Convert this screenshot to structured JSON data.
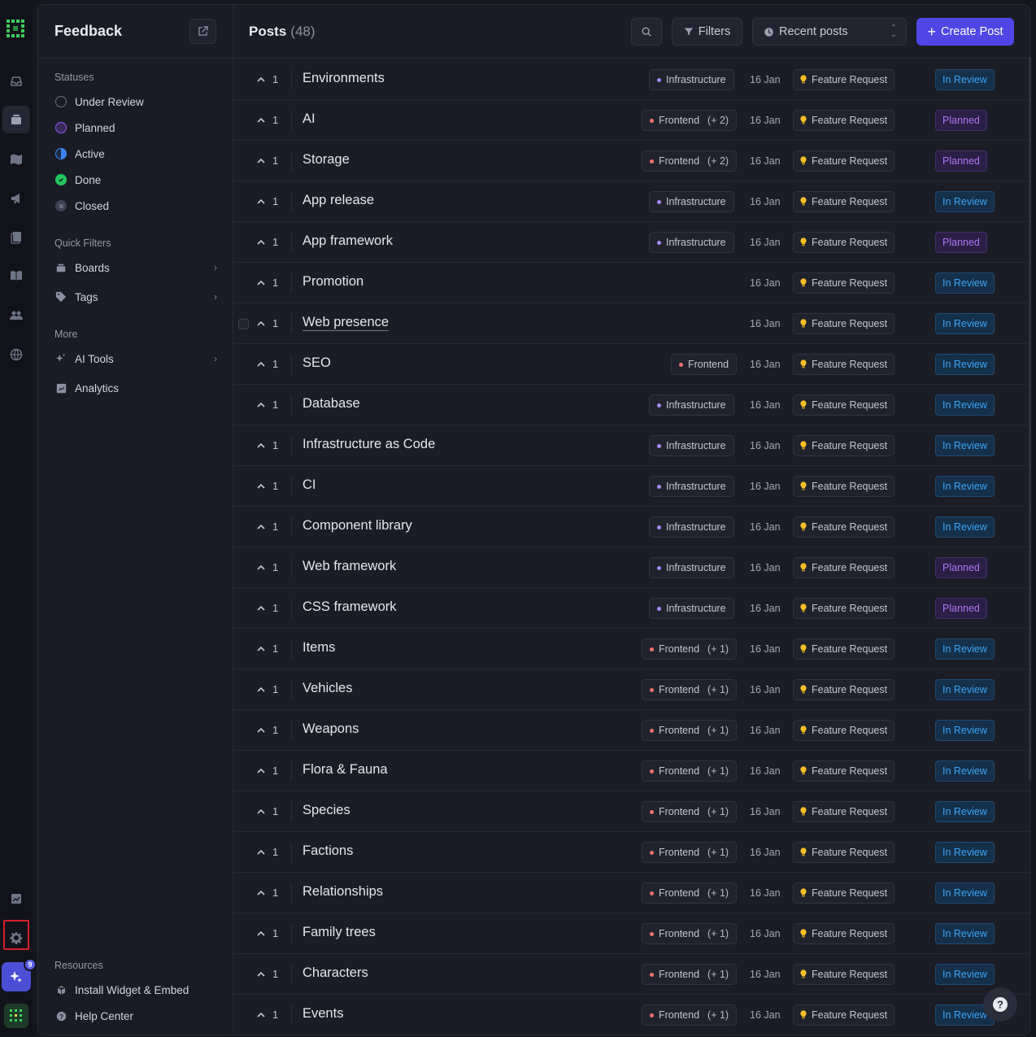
{
  "sidebar": {
    "title": "Feedback",
    "statuses_label": "Statuses",
    "statuses": [
      {
        "label": "Under Review",
        "color": "#6b7080"
      },
      {
        "label": "Planned",
        "color": "#8b5cf6"
      },
      {
        "label": "Active",
        "color": "#3b82f6"
      },
      {
        "label": "Done",
        "color": "#22c55e"
      },
      {
        "label": "Closed",
        "color": "#5b6275"
      }
    ],
    "quick_filters_label": "Quick Filters",
    "quick_filters": [
      {
        "label": "Boards",
        "icon": "boards-icon"
      },
      {
        "label": "Tags",
        "icon": "tag-icon"
      }
    ],
    "more_label": "More",
    "more": [
      {
        "label": "AI Tools",
        "icon": "sparkle-icon"
      },
      {
        "label": "Analytics",
        "icon": "chart-icon"
      }
    ],
    "resources_label": "Resources",
    "resources": [
      {
        "label": "Install Widget & Embed",
        "icon": "cube-icon"
      },
      {
        "label": "Help Center",
        "icon": "help-circle-icon"
      }
    ]
  },
  "rail": {
    "badge": "9"
  },
  "header": {
    "title": "Posts",
    "count": "(48)",
    "filters_label": "Filters",
    "sort_label": "Recent posts",
    "create_label": "Create Post"
  },
  "colors": {
    "accent": "#4f46e5",
    "infrastructure": "#a78bfa",
    "frontend": "#f87171",
    "feature_request": "#fbbf24"
  },
  "posts": [
    {
      "votes": "1",
      "title": "Environments",
      "tag": "Infrastructure",
      "tag_color": "#a78bfa",
      "extra": "",
      "date": "16 Jan",
      "type": "Feature Request",
      "status": "In Review"
    },
    {
      "votes": "1",
      "title": "AI",
      "tag": "Frontend",
      "tag_color": "#f87171",
      "extra": "(+ 2)",
      "date": "16 Jan",
      "type": "Feature Request",
      "status": "Planned"
    },
    {
      "votes": "1",
      "title": "Storage",
      "tag": "Frontend",
      "tag_color": "#f87171",
      "extra": "(+ 2)",
      "date": "16 Jan",
      "type": "Feature Request",
      "status": "Planned"
    },
    {
      "votes": "1",
      "title": "App release",
      "tag": "Infrastructure",
      "tag_color": "#a78bfa",
      "extra": "",
      "date": "16 Jan",
      "type": "Feature Request",
      "status": "In Review"
    },
    {
      "votes": "1",
      "title": "App framework",
      "tag": "Infrastructure",
      "tag_color": "#a78bfa",
      "extra": "",
      "date": "16 Jan",
      "type": "Feature Request",
      "status": "Planned"
    },
    {
      "votes": "1",
      "title": "Promotion",
      "tag": "",
      "tag_color": "",
      "extra": "",
      "date": "16 Jan",
      "type": "Feature Request",
      "status": "In Review"
    },
    {
      "votes": "1",
      "title": "Web presence",
      "tag": "",
      "tag_color": "",
      "extra": "",
      "date": "16 Jan",
      "type": "Feature Request",
      "status": "In Review",
      "hover": true
    },
    {
      "votes": "1",
      "title": "SEO",
      "tag": "Frontend",
      "tag_color": "#f87171",
      "extra": "",
      "date": "16 Jan",
      "type": "Feature Request",
      "status": "In Review"
    },
    {
      "votes": "1",
      "title": "Database",
      "tag": "Infrastructure",
      "tag_color": "#a78bfa",
      "extra": "",
      "date": "16 Jan",
      "type": "Feature Request",
      "status": "In Review"
    },
    {
      "votes": "1",
      "title": "Infrastructure as Code",
      "tag": "Infrastructure",
      "tag_color": "#a78bfa",
      "extra": "",
      "date": "16 Jan",
      "type": "Feature Request",
      "status": "In Review"
    },
    {
      "votes": "1",
      "title": "CI",
      "tag": "Infrastructure",
      "tag_color": "#a78bfa",
      "extra": "",
      "date": "16 Jan",
      "type": "Feature Request",
      "status": "In Review"
    },
    {
      "votes": "1",
      "title": "Component library",
      "tag": "Infrastructure",
      "tag_color": "#a78bfa",
      "extra": "",
      "date": "16 Jan",
      "type": "Feature Request",
      "status": "In Review"
    },
    {
      "votes": "1",
      "title": "Web framework",
      "tag": "Infrastructure",
      "tag_color": "#a78bfa",
      "extra": "",
      "date": "16 Jan",
      "type": "Feature Request",
      "status": "Planned"
    },
    {
      "votes": "1",
      "title": "CSS framework",
      "tag": "Infrastructure",
      "tag_color": "#a78bfa",
      "extra": "",
      "date": "16 Jan",
      "type": "Feature Request",
      "status": "Planned"
    },
    {
      "votes": "1",
      "title": "Items",
      "tag": "Frontend",
      "tag_color": "#f87171",
      "extra": "(+ 1)",
      "date": "16 Jan",
      "type": "Feature Request",
      "status": "In Review"
    },
    {
      "votes": "1",
      "title": "Vehicles",
      "tag": "Frontend",
      "tag_color": "#f87171",
      "extra": "(+ 1)",
      "date": "16 Jan",
      "type": "Feature Request",
      "status": "In Review"
    },
    {
      "votes": "1",
      "title": "Weapons",
      "tag": "Frontend",
      "tag_color": "#f87171",
      "extra": "(+ 1)",
      "date": "16 Jan",
      "type": "Feature Request",
      "status": "In Review"
    },
    {
      "votes": "1",
      "title": "Flora & Fauna",
      "tag": "Frontend",
      "tag_color": "#f87171",
      "extra": "(+ 1)",
      "date": "16 Jan",
      "type": "Feature Request",
      "status": "In Review"
    },
    {
      "votes": "1",
      "title": "Species",
      "tag": "Frontend",
      "tag_color": "#f87171",
      "extra": "(+ 1)",
      "date": "16 Jan",
      "type": "Feature Request",
      "status": "In Review"
    },
    {
      "votes": "1",
      "title": "Factions",
      "tag": "Frontend",
      "tag_color": "#f87171",
      "extra": "(+ 1)",
      "date": "16 Jan",
      "type": "Feature Request",
      "status": "In Review"
    },
    {
      "votes": "1",
      "title": "Relationships",
      "tag": "Frontend",
      "tag_color": "#f87171",
      "extra": "(+ 1)",
      "date": "16 Jan",
      "type": "Feature Request",
      "status": "In Review"
    },
    {
      "votes": "1",
      "title": "Family trees",
      "tag": "Frontend",
      "tag_color": "#f87171",
      "extra": "(+ 1)",
      "date": "16 Jan",
      "type": "Feature Request",
      "status": "In Review"
    },
    {
      "votes": "1",
      "title": "Characters",
      "tag": "Frontend",
      "tag_color": "#f87171",
      "extra": "(+ 1)",
      "date": "16 Jan",
      "type": "Feature Request",
      "status": "In Review"
    },
    {
      "votes": "1",
      "title": "Events",
      "tag": "Frontend",
      "tag_color": "#f87171",
      "extra": "(+ 1)",
      "date": "16 Jan",
      "type": "Feature Request",
      "status": "In Review"
    }
  ]
}
